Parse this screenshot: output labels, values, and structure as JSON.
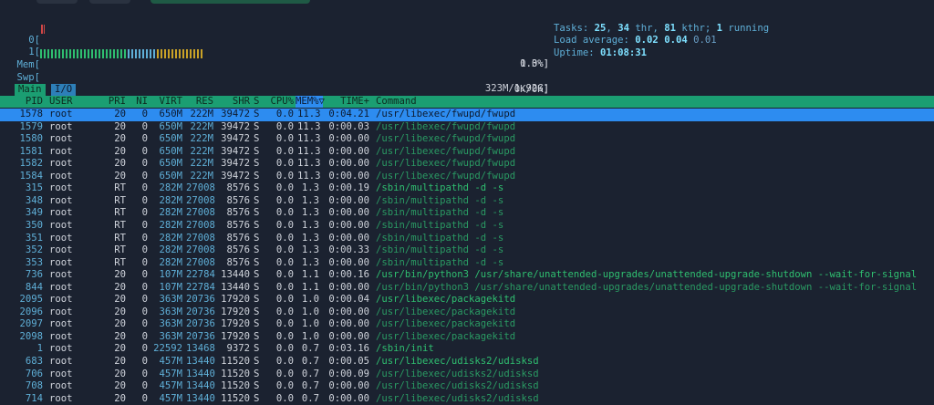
{
  "colors": {
    "background": "#1b2230",
    "header_bg": "#1b9e72",
    "selected_bg": "#2d8cf0",
    "meter_cyan": "#5fafd7",
    "command_green": "#2fbf70",
    "tab_main_bg": "#1b9e72",
    "tab_io_bg": "#2d7fb8"
  },
  "meters": {
    "cpu0": {
      "label": "0[",
      "value": "1.3%]",
      "fraction": 0.013
    },
    "cpu1": {
      "label": "1[",
      "value": "0.0%]",
      "fraction": 0.0
    },
    "mem": {
      "label": "Mem[",
      "value": "323M/1.92G]",
      "fraction": 0.17
    },
    "swp": {
      "label": "Swp[",
      "value": "0K/0K]",
      "fraction": 0.0
    }
  },
  "info": {
    "tasks_label": "Tasks: ",
    "tasks_count": "25",
    "tasks_sep": ", ",
    "threads": "34",
    "threads_label": " thr, ",
    "kthreads": "81",
    "kthreads_label": " kthr; ",
    "running": "1",
    "running_label": " running",
    "load_label": "Load average: ",
    "load1": "0.02",
    "load5": "0.04",
    "load15": "0.01",
    "uptime_label": "Uptime: ",
    "uptime": "01:08:31"
  },
  "tabs": [
    {
      "label": "Main"
    },
    {
      "label": "I/O"
    }
  ],
  "columns": {
    "pid": "PID",
    "user": "USER",
    "pri": "PRI",
    "ni": "NI",
    "virt": "VIRT",
    "res": "RES",
    "shr": "SHR",
    "s": "S",
    "cpu": "CPU%",
    "mem": "MEM%▽",
    "time": "TIME+",
    "command": "Command"
  },
  "processes": [
    {
      "pid": "1578",
      "user": "root",
      "pri": "20",
      "ni": "0",
      "virt": "650M",
      "res": "222M",
      "shr": "39472",
      "s": "S",
      "cpu": "0.0",
      "mem": "11.3",
      "time": "0:04.21",
      "cmd": "/usr/libexec/fwupd/fwupd",
      "thread": false,
      "selected": true
    },
    {
      "pid": "1579",
      "user": "root",
      "pri": "20",
      "ni": "0",
      "virt": "650M",
      "res": "222M",
      "shr": "39472",
      "s": "S",
      "cpu": "0.0",
      "mem": "11.3",
      "time": "0:00.03",
      "cmd": "/usr/libexec/fwupd/fwupd",
      "thread": true
    },
    {
      "pid": "1580",
      "user": "root",
      "pri": "20",
      "ni": "0",
      "virt": "650M",
      "res": "222M",
      "shr": "39472",
      "s": "S",
      "cpu": "0.0",
      "mem": "11.3",
      "time": "0:00.00",
      "cmd": "/usr/libexec/fwupd/fwupd",
      "thread": true
    },
    {
      "pid": "1581",
      "user": "root",
      "pri": "20",
      "ni": "0",
      "virt": "650M",
      "res": "222M",
      "shr": "39472",
      "s": "S",
      "cpu": "0.0",
      "mem": "11.3",
      "time": "0:00.00",
      "cmd": "/usr/libexec/fwupd/fwupd",
      "thread": true
    },
    {
      "pid": "1582",
      "user": "root",
      "pri": "20",
      "ni": "0",
      "virt": "650M",
      "res": "222M",
      "shr": "39472",
      "s": "S",
      "cpu": "0.0",
      "mem": "11.3",
      "time": "0:00.00",
      "cmd": "/usr/libexec/fwupd/fwupd",
      "thread": true
    },
    {
      "pid": "1584",
      "user": "root",
      "pri": "20",
      "ni": "0",
      "virt": "650M",
      "res": "222M",
      "shr": "39472",
      "s": "S",
      "cpu": "0.0",
      "mem": "11.3",
      "time": "0:00.00",
      "cmd": "/usr/libexec/fwupd/fwupd",
      "thread": true
    },
    {
      "pid": "315",
      "user": "root",
      "pri": "RT",
      "ni": "0",
      "virt": "282M",
      "res": "27008",
      "shr": "8576",
      "s": "S",
      "cpu": "0.0",
      "mem": "1.3",
      "time": "0:00.19",
      "cmd": "/sbin/multipathd -d -s",
      "thread": false
    },
    {
      "pid": "348",
      "user": "root",
      "pri": "RT",
      "ni": "0",
      "virt": "282M",
      "res": "27008",
      "shr": "8576",
      "s": "S",
      "cpu": "0.0",
      "mem": "1.3",
      "time": "0:00.00",
      "cmd": "/sbin/multipathd -d -s",
      "thread": true
    },
    {
      "pid": "349",
      "user": "root",
      "pri": "RT",
      "ni": "0",
      "virt": "282M",
      "res": "27008",
      "shr": "8576",
      "s": "S",
      "cpu": "0.0",
      "mem": "1.3",
      "time": "0:00.00",
      "cmd": "/sbin/multipathd -d -s",
      "thread": true
    },
    {
      "pid": "350",
      "user": "root",
      "pri": "RT",
      "ni": "0",
      "virt": "282M",
      "res": "27008",
      "shr": "8576",
      "s": "S",
      "cpu": "0.0",
      "mem": "1.3",
      "time": "0:00.00",
      "cmd": "/sbin/multipathd -d -s",
      "thread": true
    },
    {
      "pid": "351",
      "user": "root",
      "pri": "RT",
      "ni": "0",
      "virt": "282M",
      "res": "27008",
      "shr": "8576",
      "s": "S",
      "cpu": "0.0",
      "mem": "1.3",
      "time": "0:00.00",
      "cmd": "/sbin/multipathd -d -s",
      "thread": true
    },
    {
      "pid": "352",
      "user": "root",
      "pri": "RT",
      "ni": "0",
      "virt": "282M",
      "res": "27008",
      "shr": "8576",
      "s": "S",
      "cpu": "0.0",
      "mem": "1.3",
      "time": "0:00.33",
      "cmd": "/sbin/multipathd -d -s",
      "thread": true
    },
    {
      "pid": "353",
      "user": "root",
      "pri": "RT",
      "ni": "0",
      "virt": "282M",
      "res": "27008",
      "shr": "8576",
      "s": "S",
      "cpu": "0.0",
      "mem": "1.3",
      "time": "0:00.00",
      "cmd": "/sbin/multipathd -d -s",
      "thread": true
    },
    {
      "pid": "736",
      "user": "root",
      "pri": "20",
      "ni": "0",
      "virt": "107M",
      "res": "22784",
      "shr": "13440",
      "s": "S",
      "cpu": "0.0",
      "mem": "1.1",
      "time": "0:00.16",
      "cmd": "/usr/bin/python3 /usr/share/unattended-upgrades/unattended-upgrade-shutdown --wait-for-signal",
      "thread": false
    },
    {
      "pid": "844",
      "user": "root",
      "pri": "20",
      "ni": "0",
      "virt": "107M",
      "res": "22784",
      "shr": "13440",
      "s": "S",
      "cpu": "0.0",
      "mem": "1.1",
      "time": "0:00.00",
      "cmd": "/usr/bin/python3 /usr/share/unattended-upgrades/unattended-upgrade-shutdown --wait-for-signal",
      "thread": true
    },
    {
      "pid": "2095",
      "user": "root",
      "pri": "20",
      "ni": "0",
      "virt": "363M",
      "res": "20736",
      "shr": "17920",
      "s": "S",
      "cpu": "0.0",
      "mem": "1.0",
      "time": "0:00.04",
      "cmd": "/usr/libexec/packagekitd",
      "thread": false
    },
    {
      "pid": "2096",
      "user": "root",
      "pri": "20",
      "ni": "0",
      "virt": "363M",
      "res": "20736",
      "shr": "17920",
      "s": "S",
      "cpu": "0.0",
      "mem": "1.0",
      "time": "0:00.00",
      "cmd": "/usr/libexec/packagekitd",
      "thread": true
    },
    {
      "pid": "2097",
      "user": "root",
      "pri": "20",
      "ni": "0",
      "virt": "363M",
      "res": "20736",
      "shr": "17920",
      "s": "S",
      "cpu": "0.0",
      "mem": "1.0",
      "time": "0:00.00",
      "cmd": "/usr/libexec/packagekitd",
      "thread": true
    },
    {
      "pid": "2098",
      "user": "root",
      "pri": "20",
      "ni": "0",
      "virt": "363M",
      "res": "20736",
      "shr": "17920",
      "s": "S",
      "cpu": "0.0",
      "mem": "1.0",
      "time": "0:00.00",
      "cmd": "/usr/libexec/packagekitd",
      "thread": true
    },
    {
      "pid": "1",
      "user": "root",
      "pri": "20",
      "ni": "0",
      "virt": "22592",
      "res": "13468",
      "shr": "9372",
      "s": "S",
      "cpu": "0.0",
      "mem": "0.7",
      "time": "0:03.16",
      "cmd": "/sbin/init",
      "thread": false
    },
    {
      "pid": "683",
      "user": "root",
      "pri": "20",
      "ni": "0",
      "virt": "457M",
      "res": "13440",
      "shr": "11520",
      "s": "S",
      "cpu": "0.0",
      "mem": "0.7",
      "time": "0:00.05",
      "cmd": "/usr/libexec/udisks2/udisksd",
      "thread": false
    },
    {
      "pid": "706",
      "user": "root",
      "pri": "20",
      "ni": "0",
      "virt": "457M",
      "res": "13440",
      "shr": "11520",
      "s": "S",
      "cpu": "0.0",
      "mem": "0.7",
      "time": "0:00.09",
      "cmd": "/usr/libexec/udisks2/udisksd",
      "thread": true
    },
    {
      "pid": "708",
      "user": "root",
      "pri": "20",
      "ni": "0",
      "virt": "457M",
      "res": "13440",
      "shr": "11520",
      "s": "S",
      "cpu": "0.0",
      "mem": "0.7",
      "time": "0:00.00",
      "cmd": "/usr/libexec/udisks2/udisksd",
      "thread": true
    },
    {
      "pid": "714",
      "user": "root",
      "pri": "20",
      "ni": "0",
      "virt": "457M",
      "res": "13440",
      "shr": "11520",
      "s": "S",
      "cpu": "0.0",
      "mem": "0.7",
      "time": "0:00.00",
      "cmd": "/usr/libexec/udisks2/udisksd",
      "thread": true
    }
  ]
}
